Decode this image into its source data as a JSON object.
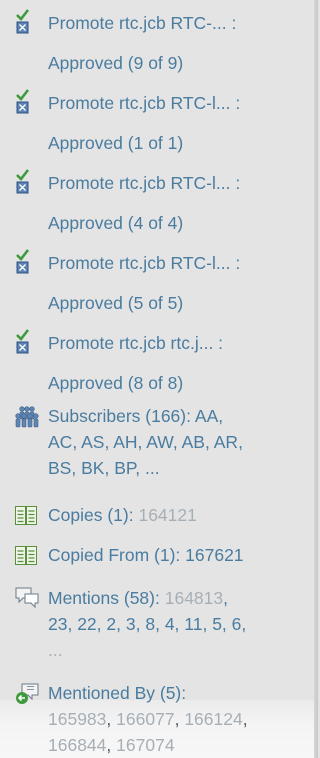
{
  "approvals": [
    {
      "title": "Promote rtc.jcb RTC-... :",
      "status": "Approved (9 of 9)"
    },
    {
      "title": "Promote rtc.jcb RTC-l... :",
      "status": "Approved (1 of 1)"
    },
    {
      "title": "Promote rtc.jcb RTC-l... :",
      "status": "Approved (4 of 4)"
    },
    {
      "title": "Promote rtc.jcb RTC-l... :",
      "status": "Approved (5 of 5)"
    },
    {
      "title": "Promote rtc.jcb rtc.j... :",
      "status": "Approved (8 of 8)"
    }
  ],
  "subscribers": {
    "label": "Subscribers (166):",
    "names": [
      "AA",
      "AC",
      "AS",
      "AH",
      "AW",
      "AB",
      "AR",
      "BS",
      "BK",
      "BP"
    ],
    "more": "..."
  },
  "copies": {
    "label": "Copies (1):",
    "items": [
      "164121"
    ]
  },
  "copied_from": {
    "label": "Copied From (1):",
    "items": [
      "167621"
    ]
  },
  "mentions": {
    "label": "Mentions (58):",
    "items": [
      "164813",
      "23",
      "22",
      "2",
      "3",
      "8",
      "4",
      "11",
      "5",
      "6"
    ],
    "more": "..."
  },
  "mentioned_by": {
    "label": "Mentioned By (5):",
    "items": [
      "165983",
      "166077",
      "166124",
      "166844",
      "167074"
    ]
  },
  "icons": {
    "approval": "approval-check-icon",
    "subscribers": "people-group-icon",
    "copies": "copy-document-icon",
    "mentions": "speech-bubble-icon",
    "mentioned_by": "mentioned-by-icon"
  },
  "colors": {
    "link": "#4a7c9f",
    "grey": "#a7afb6",
    "check": "#3c9a3c"
  }
}
